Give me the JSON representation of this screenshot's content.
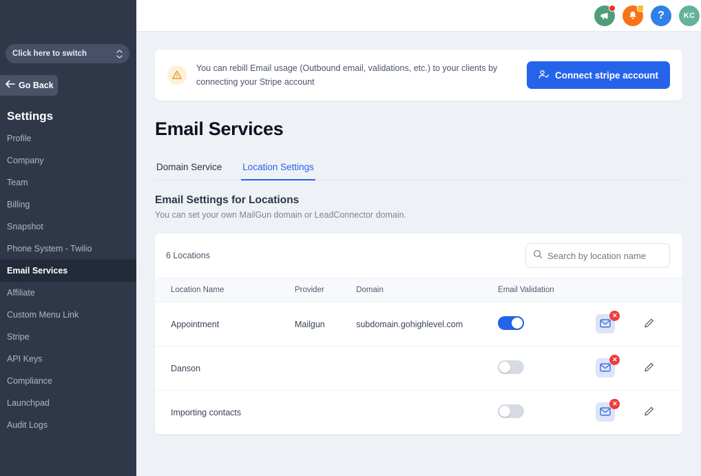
{
  "sidebar": {
    "switcher": {
      "label": "Click here to switch",
      "icon": "chevron-updown-icon"
    },
    "go_back": {
      "label": "Go Back",
      "icon": "arrow-left-icon"
    },
    "section_title": "Settings",
    "items": [
      {
        "label": "Profile",
        "active": false
      },
      {
        "label": "Company",
        "active": false
      },
      {
        "label": "Team",
        "active": false
      },
      {
        "label": "Billing",
        "active": false
      },
      {
        "label": "Snapshot",
        "active": false
      },
      {
        "label": "Phone System - Twilio",
        "active": false
      },
      {
        "label": "Email Services",
        "active": true
      },
      {
        "label": "Affiliate",
        "active": false
      },
      {
        "label": "Custom Menu Link",
        "active": false
      },
      {
        "label": "Stripe",
        "active": false
      },
      {
        "label": "API Keys",
        "active": false
      },
      {
        "label": "Compliance",
        "active": false
      },
      {
        "label": "Launchpad",
        "active": false
      },
      {
        "label": "Audit Logs",
        "active": false
      }
    ],
    "bg_color": "#2f3749",
    "active_bg_color": "#232a39"
  },
  "topbar": {
    "icons": [
      {
        "name": "megaphone-icon",
        "badge": "red",
        "color": "#4e9e78"
      },
      {
        "name": "bell-icon",
        "badge": "yellow",
        "color": "#f97316"
      },
      {
        "name": "help-icon",
        "label": "?",
        "color": "#2f80e8"
      }
    ],
    "avatar": {
      "initials": "KC",
      "color": "#63b39b"
    }
  },
  "banner": {
    "icon": "warning-triangle-icon",
    "text": "You can rebill Email usage (Outbound email, validations, etc.) to your clients by connecting your Stripe account",
    "button": {
      "label": "Connect stripe account",
      "icon": "user-check-icon",
      "color": "#2563eb"
    }
  },
  "page": {
    "title": "Email Services",
    "tabs": [
      {
        "label": "Domain Service",
        "active": false
      },
      {
        "label": "Location Settings",
        "active": true
      }
    ],
    "accent_color": "#2563eb",
    "section_title": "Email Settings for Locations",
    "section_subtitle": "You can set your own MailGun domain or LeadConnector domain."
  },
  "table": {
    "count_label": "6 Locations",
    "search": {
      "placeholder": "Search by location name",
      "value": "",
      "icon": "search-icon"
    },
    "columns": [
      "Location Name",
      "Provider",
      "Domain",
      "Email Validation",
      "",
      ""
    ],
    "rows": [
      {
        "location_name": "Appointment",
        "provider": "Mailgun",
        "domain": "subdomain.gohighlevel.com",
        "email_validation": true,
        "mail_icon": "mail-verify-icon",
        "mail_badge": "✕",
        "edit_icon": "pencil-icon"
      },
      {
        "location_name": "Danson",
        "provider": "",
        "domain": "",
        "email_validation": false,
        "mail_icon": "mail-verify-icon",
        "mail_badge": "✕",
        "edit_icon": "pencil-icon"
      },
      {
        "location_name": "Importing contacts",
        "provider": "",
        "domain": "",
        "email_validation": false,
        "mail_icon": "mail-verify-icon",
        "mail_badge": "✕",
        "edit_icon": "pencil-icon"
      }
    ]
  }
}
